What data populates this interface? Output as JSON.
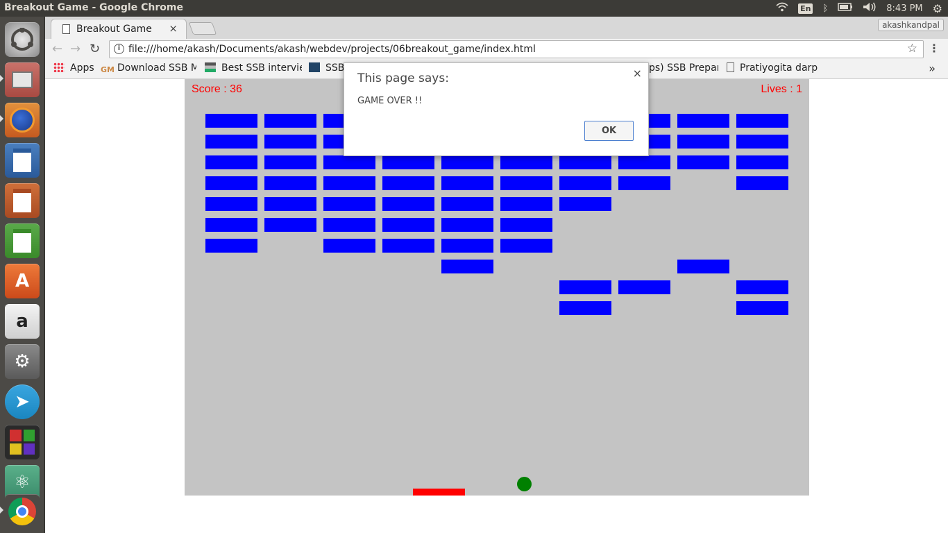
{
  "system": {
    "window_title": "Breakout Game - Google Chrome",
    "keyboard_layout": "En",
    "clock": "8:43 PM"
  },
  "chrome": {
    "tab_title": "Breakout Game",
    "tab_close": "×",
    "profile_name": "akashkandpal",
    "url": "file:///home/akash/Documents/akash/webdev/projects/06breakout_game/index.html",
    "bookmarks": [
      {
        "label": "Apps"
      },
      {
        "label": "Download SSB M"
      },
      {
        "label": "Best SSB intervie"
      },
      {
        "label": "SSB"
      },
      {
        "label": "ps) SSB Prepar"
      },
      {
        "label": "Pratiyogita darp"
      }
    ],
    "bookmarks_more": "»"
  },
  "game": {
    "score_text": "Score : 36",
    "lives_text": "Lives : 1",
    "brick_color": "#0000ff",
    "paddle_color": "#ff0000",
    "ball_color": "#008000",
    "canvas_color": "#c4c4c4",
    "bricks_grid": [
      [
        1,
        1,
        1,
        1,
        1,
        1,
        1,
        1,
        1,
        1
      ],
      [
        1,
        1,
        1,
        1,
        1,
        1,
        1,
        1,
        1,
        1
      ],
      [
        1,
        1,
        1,
        1,
        1,
        1,
        1,
        1,
        1,
        1
      ],
      [
        1,
        1,
        1,
        1,
        1,
        1,
        1,
        1,
        0,
        1
      ],
      [
        1,
        1,
        1,
        1,
        1,
        1,
        1,
        0,
        0,
        0
      ],
      [
        1,
        1,
        1,
        1,
        1,
        1,
        0,
        0,
        0,
        0
      ],
      [
        1,
        0,
        1,
        1,
        1,
        1,
        0,
        0,
        0,
        0
      ],
      [
        0,
        0,
        0,
        0,
        1,
        0,
        0,
        0,
        1,
        0
      ],
      [
        0,
        0,
        0,
        0,
        0,
        0,
        1,
        1,
        0,
        1
      ],
      [
        0,
        0,
        0,
        0,
        0,
        0,
        1,
        0,
        0,
        1
      ]
    ]
  },
  "dialog": {
    "title": "This page says:",
    "message": "GAME OVER !!",
    "ok_label": "OK",
    "close": "×"
  }
}
